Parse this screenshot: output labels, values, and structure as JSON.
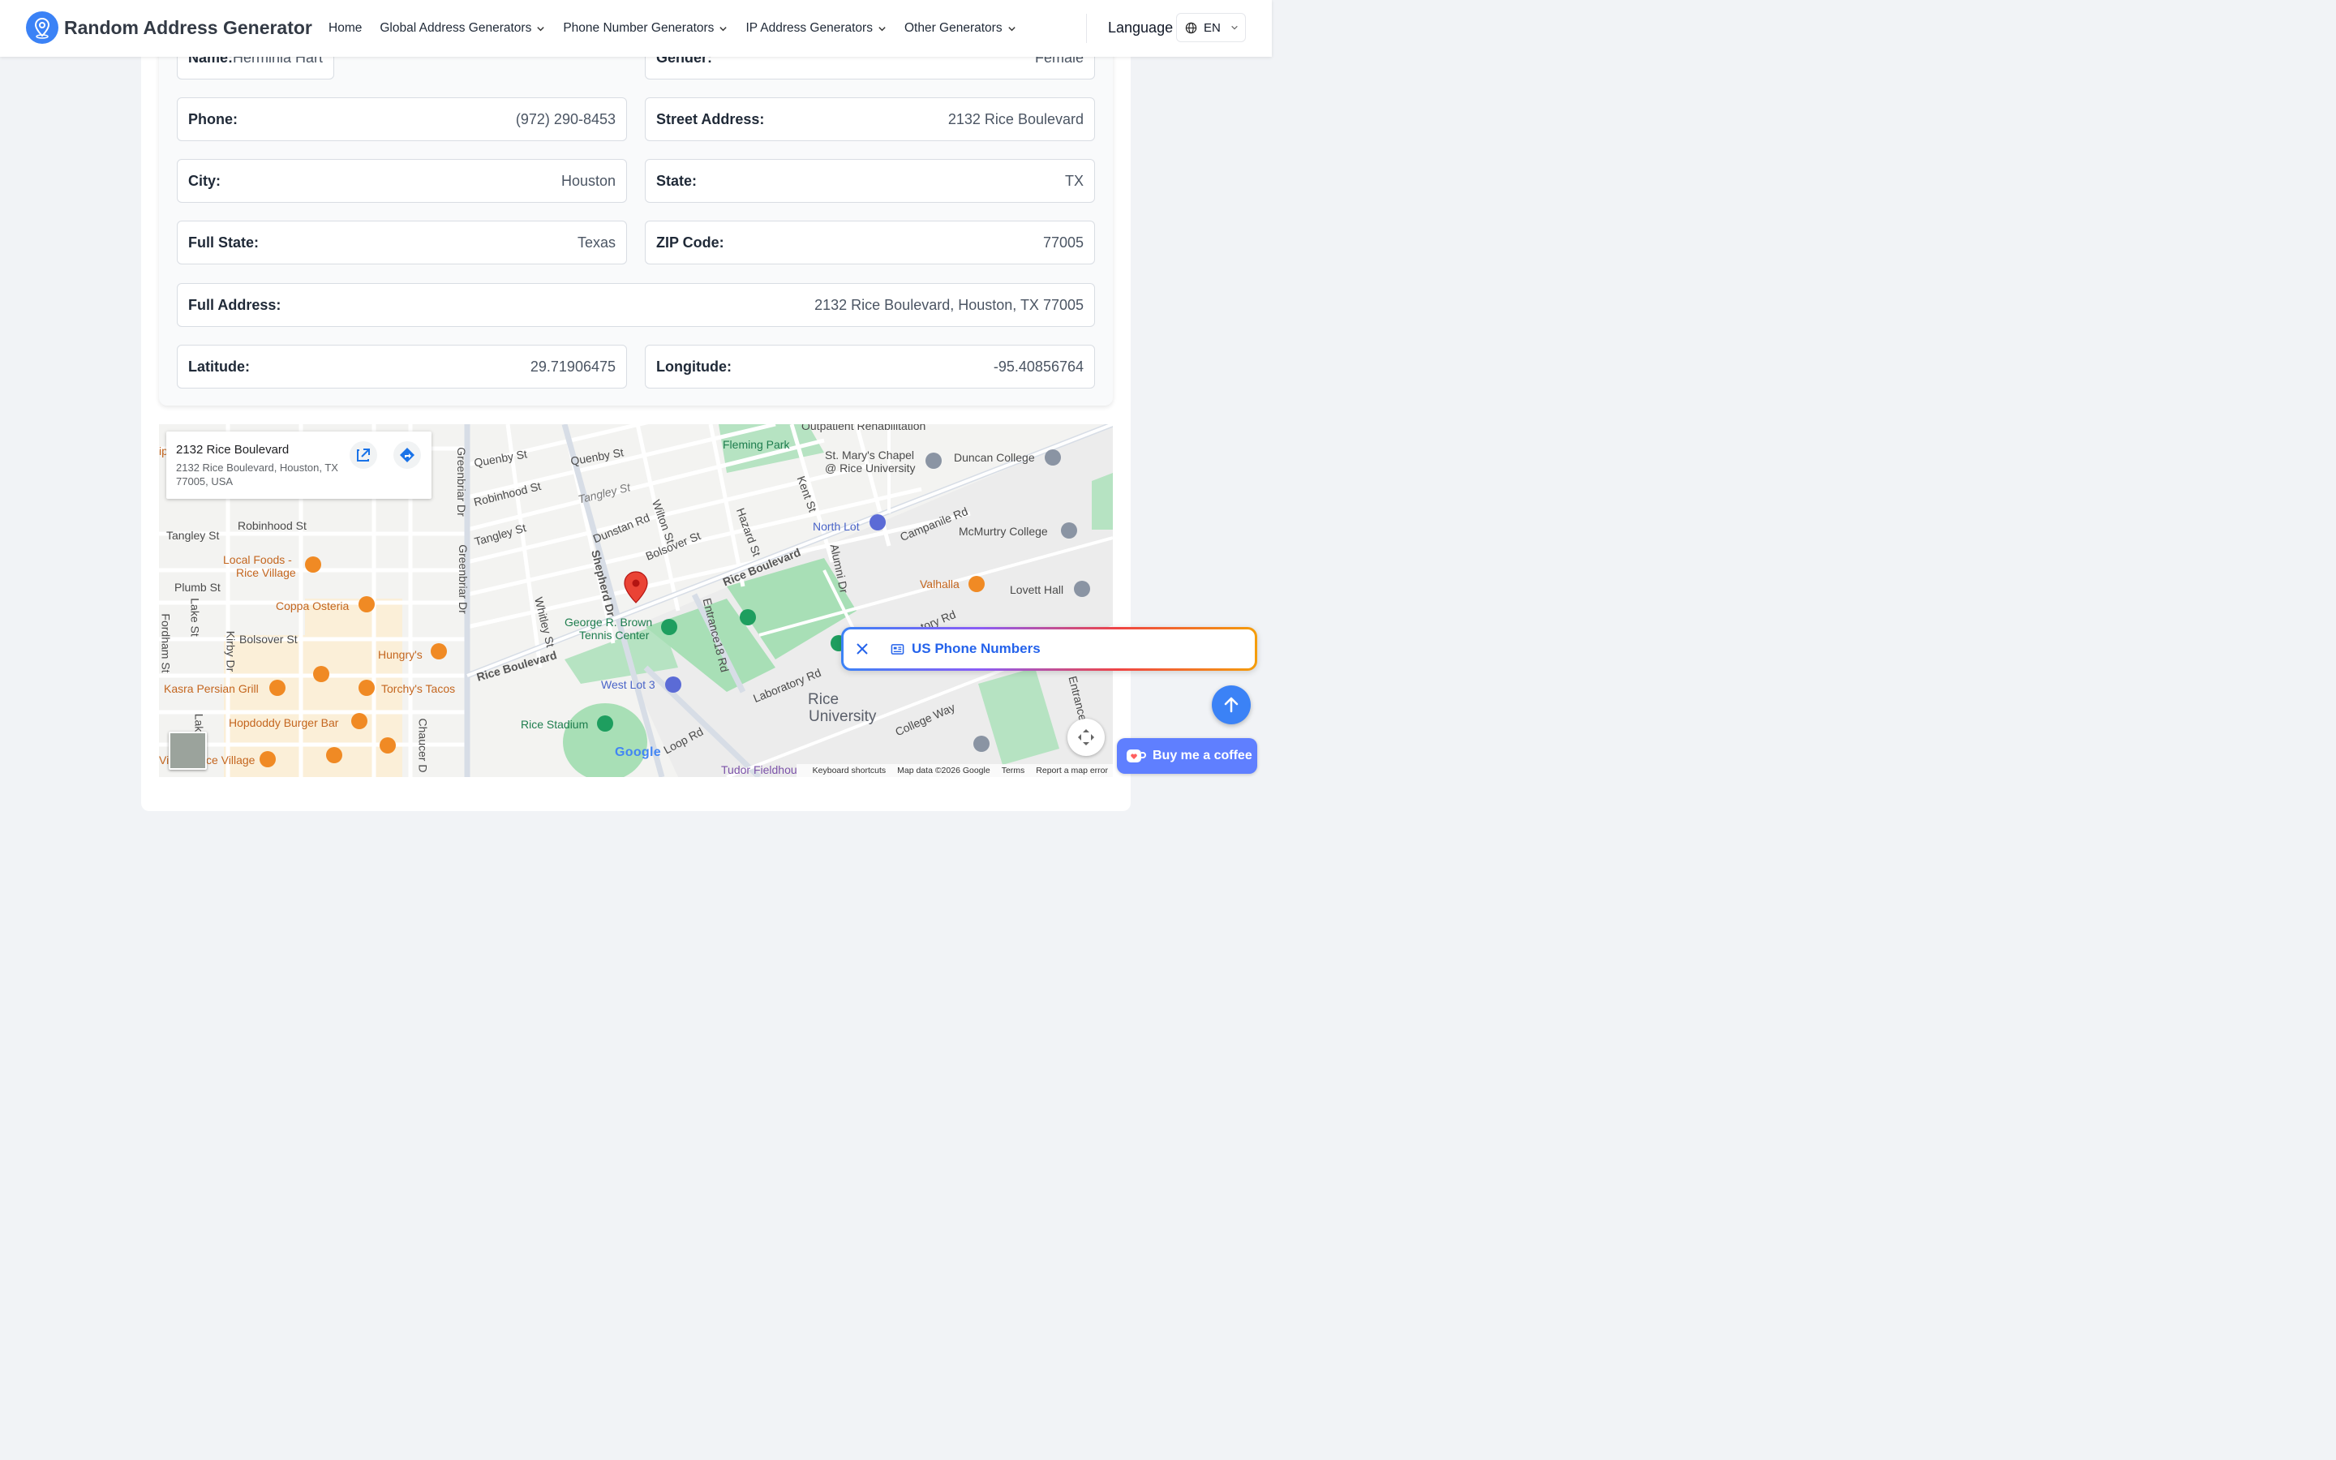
{
  "header": {
    "brand": "Random Address Generator",
    "nav": [
      {
        "label": "Home",
        "has_dropdown": false
      },
      {
        "label": "Global Address Generators",
        "has_dropdown": true
      },
      {
        "label": "Phone Number Generators",
        "has_dropdown": true
      },
      {
        "label": "IP Address Generators",
        "has_dropdown": true
      },
      {
        "label": "Other Generators",
        "has_dropdown": true
      }
    ],
    "language_label": "Language",
    "language_code": "EN"
  },
  "fields": {
    "name": {
      "label": "Name:",
      "value": "Herminia Hart"
    },
    "gender": {
      "label": "Gender:",
      "value": "Female"
    },
    "phone": {
      "label": "Phone:",
      "value": "(972) 290-8453"
    },
    "street": {
      "label": "Street Address:",
      "value": "2132 Rice Boulevard"
    },
    "city": {
      "label": "City:",
      "value": "Houston"
    },
    "state": {
      "label": "State:",
      "value": "TX"
    },
    "full_state": {
      "label": "Full State:",
      "value": "Texas"
    },
    "zip": {
      "label": "ZIP Code:",
      "value": "77005"
    },
    "full_address": {
      "label": "Full Address:",
      "value": "2132 Rice Boulevard, Houston, TX 77005"
    },
    "latitude": {
      "label": "Latitude:",
      "value": "29.71906475"
    },
    "longitude": {
      "label": "Longitude:",
      "value": "-95.40856764"
    }
  },
  "map": {
    "info_title": "2132 Rice Boulevard",
    "info_address": "2132 Rice Boulevard, Houston, TX 77005, USA",
    "labels": {
      "outpatient": "Outpatient Rehabilitation",
      "fleming_park": "Fleming Park",
      "st_marys": "St. Mary's Chapel",
      "st_marys_2": "@ Rice University",
      "duncan": "Duncan College",
      "quenby1": "Quenby St",
      "quenby2": "Quenby St",
      "greenbriar1": "Greenbriar Dr",
      "greenbriar2": "Greenbriar Dr",
      "robinhood1": "Robinhood St",
      "robinhood2": "Robinhood St",
      "tangley1": "Tangley St",
      "tangley2": "Tangley St",
      "tangley3": "Tangley St",
      "dunstan": "Dunstan Rd",
      "wilton": "Wilton St",
      "hazard": "Hazard St",
      "kent": "Kent St",
      "north_lot": "North Lot",
      "campanile": "Campanile Rd",
      "mcmurtry": "McMurtry College",
      "bolsover1": "Bolsover St",
      "bolsover2": "Bolsover St",
      "local_foods": "Local Foods -",
      "local_foods_2": "Rice Village",
      "plumb": "Plumb St",
      "alumni": "Alumni Dr",
      "valhalla": "Valhalla",
      "lovett": "Lovett Hall",
      "rice_blvd1": "Rice Boulevard",
      "rice_blvd2": "Rice Boulevard",
      "shepherd": "Shepherd Dr",
      "coppa": "Coppa Osteria",
      "lake": "Lake St",
      "whitley": "Whitley St",
      "brown1": "George R. Brown",
      "brown2": "Tennis Center",
      "entrance18": "Entrance18 Rd",
      "fordham": "Fordham St",
      "kirby": "Kirby Dr",
      "hungrys": "Hungry's",
      "kasra": "Kasra Persian Grill",
      "torchys": "Torchy's Tacos",
      "west_lot": "West Lot 3",
      "laboratory": "Laboratory Rd",
      "rice_univ1": "Rice",
      "rice_univ2": "University",
      "hopdoddy": "Hopdoddy Burger Bar",
      "chaucer": "Chaucer D",
      "rice_stadium": "Rice Stadium",
      "college_way": "College Way",
      "loop": "Loop Rd",
      "village": "Vi",
      "village2": "ce Village",
      "tudor": "Tudor Fieldhou",
      "entrance_right": "Entrance",
      "story": "tory Rd",
      "lak": "Lak",
      "ip": "ip"
    },
    "footer": {
      "shortcuts": "Keyboard shortcuts",
      "data": "Map data ©2026 Google",
      "terms": "Terms",
      "report": "Report a map error"
    },
    "google": "Google"
  },
  "toast": {
    "label": "US Phone Numbers"
  },
  "coffee": {
    "label": "Buy me a coffee"
  },
  "colors": {
    "accent": "#3b82f6",
    "toast_text": "#2563eb",
    "coffee_bg": "#5f7fff",
    "map_pin": "#ea4335",
    "park": "#a8dfb6"
  },
  "icons": {
    "brand": "location-pin-icon",
    "language": "globe-icon",
    "toast": "newspaper-icon",
    "scroll": "arrow-up-icon",
    "coffee": "coffee-cup-icon"
  }
}
